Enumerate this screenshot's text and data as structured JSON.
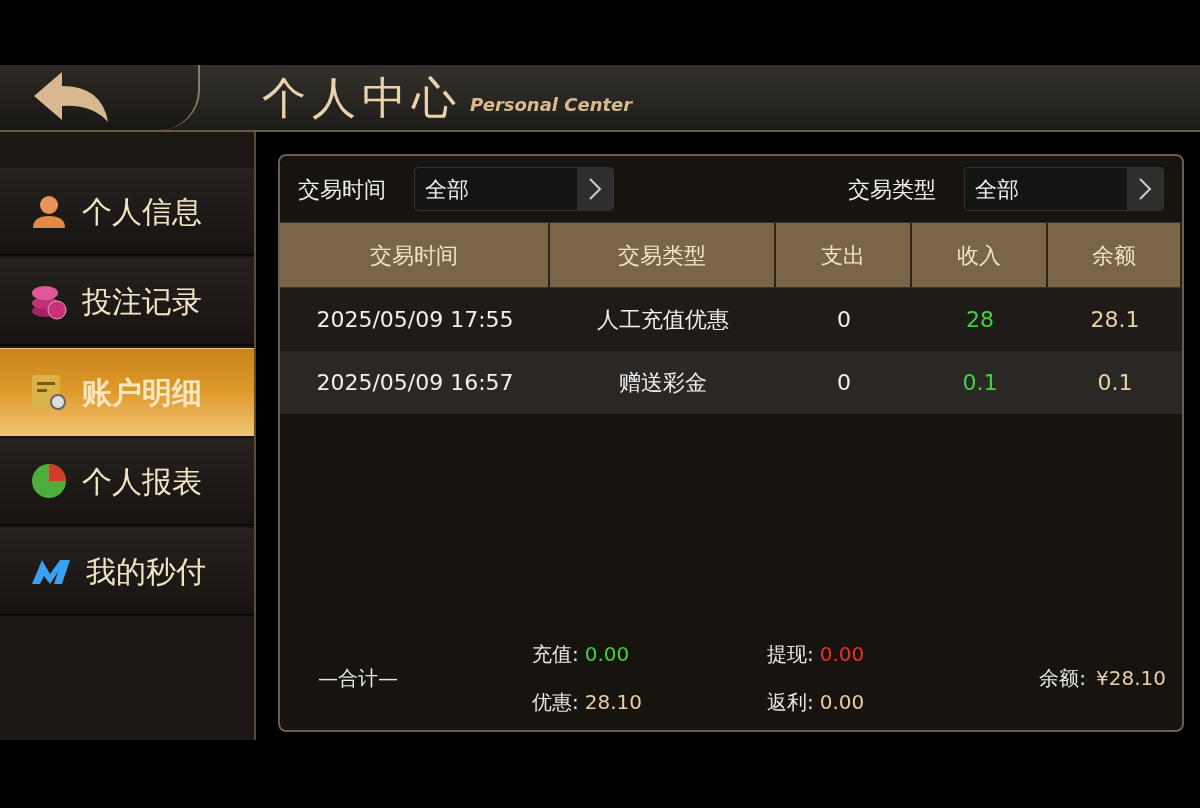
{
  "header": {
    "title": "个人中心",
    "subtitle": "Personal Center"
  },
  "sidebar": {
    "items": [
      {
        "label": "个人信息",
        "kind": "person",
        "selected": false
      },
      {
        "label": "投注记录",
        "kind": "coins",
        "selected": false
      },
      {
        "label": "账户明细",
        "kind": "ledger",
        "selected": true
      },
      {
        "label": "个人报表",
        "kind": "pie",
        "selected": false
      },
      {
        "label": "我的秒付",
        "kind": "m",
        "selected": false
      }
    ]
  },
  "filters": [
    {
      "label": "交易时间",
      "value": "全部"
    },
    {
      "label": "交易类型",
      "value": "全部"
    }
  ],
  "table": {
    "columns": [
      "交易时间",
      "交易类型",
      "支出",
      "收入",
      "余额"
    ],
    "rows": [
      [
        "2025/05/09 17:55",
        "人工充值优惠",
        "0",
        "28",
        "28.1"
      ],
      [
        "2025/05/09 16:57",
        "赠送彩金",
        "0",
        "0.1",
        "0.1"
      ]
    ]
  },
  "summary": {
    "label": "—合计—",
    "items": [
      {
        "label": "充值:",
        "value": "0.00",
        "color": "#3fd43f"
      },
      {
        "label": "提现:",
        "value": "0.00",
        "color": "#e8302c"
      },
      {
        "label": "优惠:",
        "value": "28.10",
        "color": "#e6d0a8"
      },
      {
        "label": "返利:",
        "value": "0.00",
        "color": "#e6d0a8"
      }
    ],
    "balance": {
      "label": "余额:",
      "value": "¥28.10"
    }
  }
}
